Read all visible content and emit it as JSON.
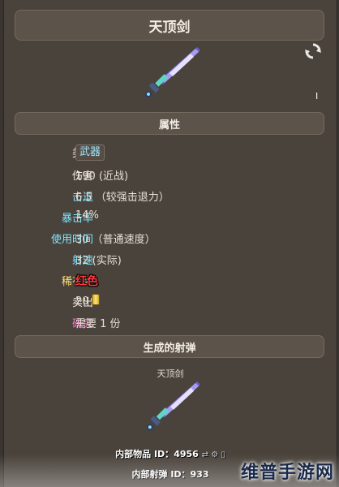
{
  "item": {
    "title": "天顶剑"
  },
  "sections": {
    "attributes": "属性",
    "projectiles": "生成的射弹"
  },
  "stats": [
    {
      "key": "类型",
      "value": "武器",
      "key_color": "white"
    },
    {
      "key": "伤害",
      "value": "190 (近战)",
      "key_color": "white"
    },
    {
      "key": "击退",
      "value": "6.5 （较强击退力）",
      "key_color": "cyan"
    },
    {
      "key": "暴击率",
      "value": "14%",
      "key_color": "cyan"
    },
    {
      "key": "使用时间",
      "value": "30 （普通速度）",
      "key_color": "cyan"
    },
    {
      "key": "射速",
      "value": "32 (实际)",
      "key_color": "cyan"
    },
    {
      "key": "稀有度",
      "value": "红色",
      "key_color": "yellow"
    },
    {
      "key": "卖出",
      "value": "20",
      "key_color": "white"
    },
    {
      "key": "研究",
      "value": "需要 1 份",
      "key_color": "pink"
    }
  ],
  "corner_mark": "I",
  "projectile": {
    "name": "天顶剑"
  },
  "footer": {
    "item_id_label": "内部物品 ID：",
    "item_id": "4956",
    "projectile_id_label": "内部射弹 ID：",
    "projectile_id": "933"
  },
  "watermark": "维普手游网",
  "colors": {
    "panel": "#4a433c",
    "header": "#5c534a",
    "cyan": "#7fe4ff",
    "rarity_red": "#ff3a44",
    "pink": "#ff6fd2"
  },
  "icons": [
    "refresh-icon",
    "zenith-sword-icon",
    "gold-coin-icon",
    "zenith-projectile-icon"
  ]
}
